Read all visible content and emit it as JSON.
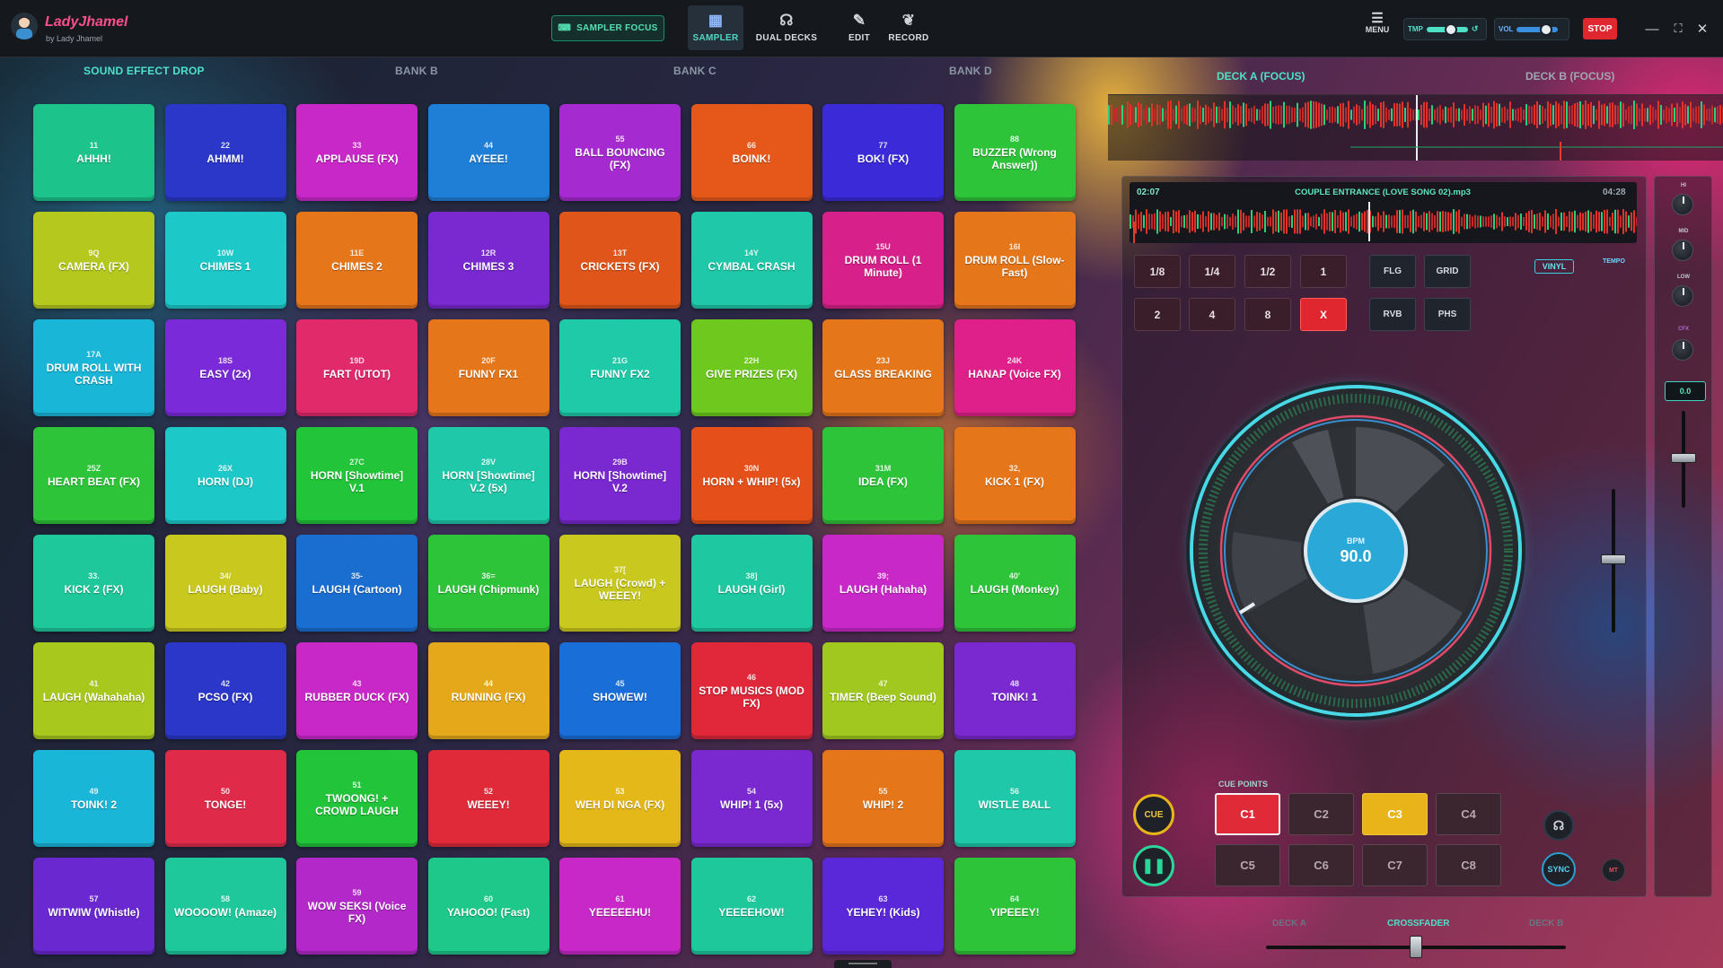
{
  "app": {
    "brand": "LadyJhamel",
    "subtitle": "by Lady Jhamel"
  },
  "topbar": {
    "sampler_focus": "SAMPLER FOCUS",
    "nav": [
      {
        "label": "SAMPLER",
        "icon": "grid-icon"
      },
      {
        "label": "DUAL DECKS",
        "icon": "headphones-icon"
      },
      {
        "label": "EDIT",
        "icon": "pencil-icon"
      },
      {
        "label": "RECORD",
        "icon": "wand-icon"
      }
    ],
    "menu": "MENU",
    "tmp_label": "TMP",
    "tmp_value": 0.6,
    "vol_label": "VOL",
    "vol_value": 0.7,
    "stop": "STOP"
  },
  "banks": [
    "SOUND EFFECT DROP",
    "BANK B",
    "BANK C",
    "BANK D"
  ],
  "pads": [
    {
      "key": "11",
      "name": "AHHH!",
      "color": "#1cc38a"
    },
    {
      "key": "22",
      "name": "AHMM!",
      "color": "#2a37c8"
    },
    {
      "key": "33",
      "name": "APPLAUSE (FX)",
      "color": "#c828c8"
    },
    {
      "key": "44",
      "name": "AYEEE!",
      "color": "#1f7fd6"
    },
    {
      "key": "55",
      "name": "BALL BOUNCING (FX)",
      "color": "#a52ad0"
    },
    {
      "key": "66",
      "name": "BOINK!",
      "color": "#e5581a"
    },
    {
      "key": "77",
      "name": "BOK! (FX)",
      "color": "#3a2ad8"
    },
    {
      "key": "88",
      "name": "BUZZER (Wrong Answer))",
      "color": "#2ec43a"
    },
    {
      "key": "9Q",
      "name": "CAMERA (FX)",
      "color": "#b4c81e"
    },
    {
      "key": "10W",
      "name": "CHIMES 1",
      "color": "#1cc8c8"
    },
    {
      "key": "11E",
      "name": "CHIMES 2",
      "color": "#e5761a"
    },
    {
      "key": "12R",
      "name": "CHIMES 3",
      "color": "#7a28d0"
    },
    {
      "key": "13T",
      "name": "CRICKETS (FX)",
      "color": "#e0561a"
    },
    {
      "key": "14Y",
      "name": "CYMBAL CRASH",
      "color": "#1ec8a8"
    },
    {
      "key": "15U",
      "name": "DRUM ROLL (1 Minute)",
      "color": "#d8208a"
    },
    {
      "key": "16I",
      "name": "DRUM ROLL (Slow-Fast)",
      "color": "#e5761a"
    },
    {
      "key": "17A",
      "name": "DRUM ROLL WITH CRASH",
      "color": "#1ab6d8"
    },
    {
      "key": "18S",
      "name": "EASY (2x)",
      "color": "#7a2ad8"
    },
    {
      "key": "19D",
      "name": "FART (UTOT)",
      "color": "#e02a6a"
    },
    {
      "key": "20F",
      "name": "FUNNY FX1",
      "color": "#e5761a"
    },
    {
      "key": "21G",
      "name": "FUNNY FX2",
      "color": "#1ecaa8"
    },
    {
      "key": "22H",
      "name": "GIVE PRIZES (FX)",
      "color": "#6ec81e"
    },
    {
      "key": "23J",
      "name": "GLASS BREAKING",
      "color": "#e5761a"
    },
    {
      "key": "24K",
      "name": "HANAP (Voice FX)",
      "color": "#e0208a"
    },
    {
      "key": "25Z",
      "name": "HEART BEAT (FX)",
      "color": "#2ec43a"
    },
    {
      "key": "26X",
      "name": "HORN (DJ)",
      "color": "#1cc8c8"
    },
    {
      "key": "27C",
      "name": "HORN [Showtime] V.1",
      "color": "#22c43a"
    },
    {
      "key": "28V",
      "name": "HORN [Showtime] V.2 (5x)",
      "color": "#1ec8a8"
    },
    {
      "key": "29B",
      "name": "HORN [Showtime] V.2",
      "color": "#7a28d0"
    },
    {
      "key": "30N",
      "name": "HORN + WHIP! (5x)",
      "color": "#e5501a"
    },
    {
      "key": "31M",
      "name": "IDEA (FX)",
      "color": "#2ec43a"
    },
    {
      "key": "32,",
      "name": "KICK 1 (FX)",
      "color": "#e5761a"
    },
    {
      "key": "33.",
      "name": "KICK 2 (FX)",
      "color": "#1ec89a"
    },
    {
      "key": "34/",
      "name": "LAUGH (Baby)",
      "color": "#c8c81e"
    },
    {
      "key": "35-",
      "name": "LAUGH (Cartoon)",
      "color": "#1a6ed0"
    },
    {
      "key": "36=",
      "name": "LAUGH (Chipmunk)",
      "color": "#2ec43a"
    },
    {
      "key": "37[",
      "name": "LAUGH (Crowd) + WEEEY!",
      "color": "#c8c81e"
    },
    {
      "key": "38]",
      "name": "LAUGH (Girl)",
      "color": "#1ec8a0"
    },
    {
      "key": "39;",
      "name": "LAUGH (Hahaha)",
      "color": "#c828c8"
    },
    {
      "key": "40'",
      "name": "LAUGH (Monkey)",
      "color": "#2ec43a"
    },
    {
      "key": "41",
      "name": "LAUGH (Wahahaha)",
      "color": "#a8c81e"
    },
    {
      "key": "42",
      "name": "PCSO (FX)",
      "color": "#2a37c8"
    },
    {
      "key": "43",
      "name": "RUBBER DUCK (FX)",
      "color": "#c828c8"
    },
    {
      "key": "44",
      "name": "RUNNING (FX)",
      "color": "#e5a81a"
    },
    {
      "key": "45",
      "name": "SHOWEW!",
      "color": "#1a6ed8"
    },
    {
      "key": "46",
      "name": "STOP MUSICS (MOD FX)",
      "color": "#e0283a"
    },
    {
      "key": "47",
      "name": "TIMER (Beep Sound)",
      "color": "#a0c81e"
    },
    {
      "key": "48",
      "name": "TOINK! 1",
      "color": "#7a28d0"
    },
    {
      "key": "49",
      "name": "TOINK! 2",
      "color": "#1ab6d8"
    },
    {
      "key": "50",
      "name": "TONGE!",
      "color": "#e02a4a"
    },
    {
      "key": "51",
      "name": "TWOONG! + CROWD LAUGH",
      "color": "#22c43a"
    },
    {
      "key": "52",
      "name": "WEEEY!",
      "color": "#e02a3a"
    },
    {
      "key": "53",
      "name": "WEH DI NGA (FX)",
      "color": "#e5b81a"
    },
    {
      "key": "54",
      "name": "WHIP! 1 (5x)",
      "color": "#7a28d0"
    },
    {
      "key": "55",
      "name": "WHIP! 2",
      "color": "#e5761a"
    },
    {
      "key": "56",
      "name": "WISTLE BALL",
      "color": "#1ec8a8"
    },
    {
      "key": "57",
      "name": "WITWIW (Whistle)",
      "color": "#6a28d0"
    },
    {
      "key": "58",
      "name": "WOOOOW! (Amaze)",
      "color": "#1ec89a"
    },
    {
      "key": "59",
      "name": "WOW SEKSI (Voice FX)",
      "color": "#b228c8"
    },
    {
      "key": "60",
      "name": "YAHOOO! (Fast)",
      "color": "#1ec88a"
    },
    {
      "key": "61",
      "name": "YEEEEEHU!",
      "color": "#c828c8"
    },
    {
      "key": "62",
      "name": "YEEEEHOW!",
      "color": "#1ec89a"
    },
    {
      "key": "63",
      "name": "YEHEY! (Kids)",
      "color": "#5a28d8"
    },
    {
      "key": "64",
      "name": "YIPEEEY!",
      "color": "#2ec43a"
    }
  ],
  "deck": {
    "tab_a": "DECK A (FOCUS)",
    "tab_b": "DECK B (FOCUS)",
    "elapsed": "02:07",
    "duration": "04:28",
    "track": "COUPLE ENTRANCE (LOVE SONG 02).mp3",
    "loops": [
      "1/8",
      "1/4",
      "1/2",
      "1",
      "2",
      "4",
      "8",
      "X"
    ],
    "fx": [
      "FLG",
      "GRID",
      "RVB",
      "PHS"
    ],
    "vinyl": "VINYL",
    "tempo_label": "TEMPO",
    "eq": [
      "HI",
      "MID",
      "LOW",
      "CFX"
    ],
    "tempo_value": "0.0",
    "bpm_label": "BPM",
    "bpm": "90.0",
    "cue_points_label": "CUE POINTS",
    "cues": [
      "C1",
      "C2",
      "C3",
      "C4",
      "C5",
      "C6",
      "C7",
      "C8"
    ],
    "cue": "CUE",
    "sync": "SYNC",
    "mt": "MT"
  },
  "crossfader": {
    "left": "DECK A",
    "center": "CROSSFADER",
    "right": "DECK B",
    "position": 0.5
  }
}
